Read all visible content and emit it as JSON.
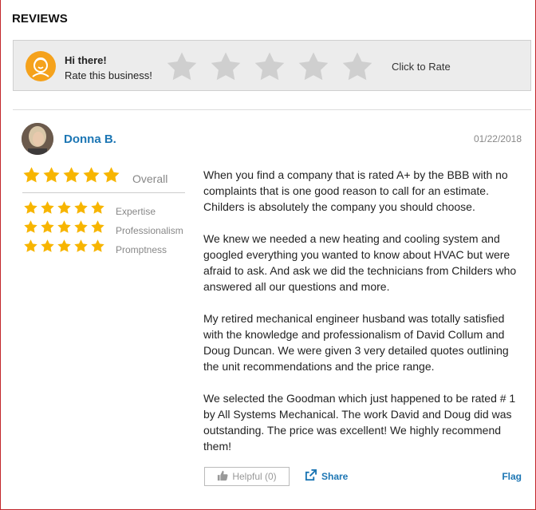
{
  "section_title": "REVIEWS",
  "rate_prompt": {
    "greeting": "Hi there!",
    "subtitle": "Rate this business!",
    "click_to_rate": "Click to Rate",
    "star_count": 5,
    "accent_color": "#f5a21c"
  },
  "review": {
    "author": "Donna B.",
    "date": "01/22/2018",
    "overall": {
      "label": "Overall",
      "rating": 5
    },
    "sub_ratings": [
      {
        "label": "Expertise",
        "rating": 5
      },
      {
        "label": "Professionalism",
        "rating": 5
      },
      {
        "label": "Promptness",
        "rating": 5
      }
    ],
    "paragraphs": [
      "When you find a company that is rated A+ by the BBB with no complaints that is one good reason to call for an estimate. Childers is absolutely the company you should choose.",
      "We knew we needed a new heating and cooling system and googled everything you wanted to know about HVAC but were afraid to ask. And ask we did the technicians from Childers who answered all our questions and more.",
      "My retired mechanical engineer husband was totally satisfied with the knowledge and professionalism of David Collum and Doug Duncan. We were given 3 very detailed quotes outlining the unit recommendations and the price range.",
      "We selected the Goodman which just happened to be rated # 1 by All Systems Mechanical. The work David and Doug did was outstanding. The price was excellent! We highly recommend them!"
    ],
    "helpful_label": "Helpful (0)",
    "share_label": "Share",
    "flag_label": "Flag"
  },
  "colors": {
    "star_gold": "#f7b500",
    "star_empty": "#cfcfcf",
    "link_blue": "#1c76b4",
    "border_red": "#c2262b"
  }
}
